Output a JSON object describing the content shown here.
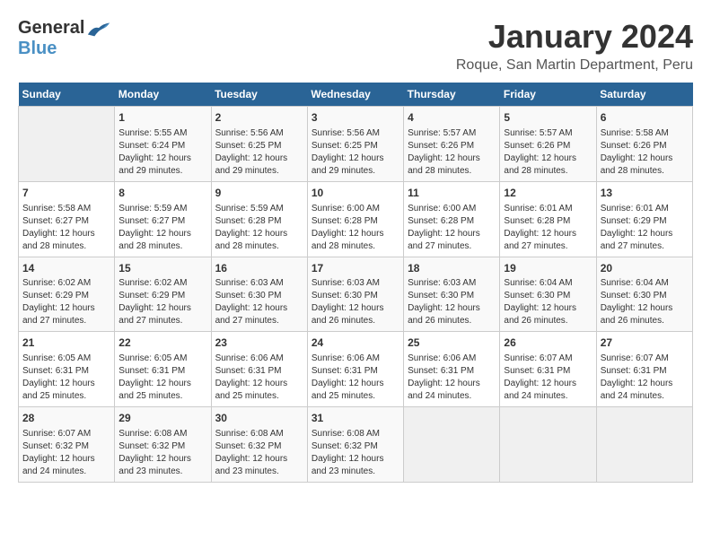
{
  "logo": {
    "general": "General",
    "blue": "Blue"
  },
  "title": "January 2024",
  "subtitle": "Roque, San Martin Department, Peru",
  "days_of_week": [
    "Sunday",
    "Monday",
    "Tuesday",
    "Wednesday",
    "Thursday",
    "Friday",
    "Saturday"
  ],
  "weeks": [
    [
      {
        "day": "",
        "info": ""
      },
      {
        "day": "1",
        "info": "Sunrise: 5:55 AM\nSunset: 6:24 PM\nDaylight: 12 hours\nand 29 minutes."
      },
      {
        "day": "2",
        "info": "Sunrise: 5:56 AM\nSunset: 6:25 PM\nDaylight: 12 hours\nand 29 minutes."
      },
      {
        "day": "3",
        "info": "Sunrise: 5:56 AM\nSunset: 6:25 PM\nDaylight: 12 hours\nand 29 minutes."
      },
      {
        "day": "4",
        "info": "Sunrise: 5:57 AM\nSunset: 6:26 PM\nDaylight: 12 hours\nand 28 minutes."
      },
      {
        "day": "5",
        "info": "Sunrise: 5:57 AM\nSunset: 6:26 PM\nDaylight: 12 hours\nand 28 minutes."
      },
      {
        "day": "6",
        "info": "Sunrise: 5:58 AM\nSunset: 6:26 PM\nDaylight: 12 hours\nand 28 minutes."
      }
    ],
    [
      {
        "day": "7",
        "info": "Sunrise: 5:58 AM\nSunset: 6:27 PM\nDaylight: 12 hours\nand 28 minutes."
      },
      {
        "day": "8",
        "info": "Sunrise: 5:59 AM\nSunset: 6:27 PM\nDaylight: 12 hours\nand 28 minutes."
      },
      {
        "day": "9",
        "info": "Sunrise: 5:59 AM\nSunset: 6:28 PM\nDaylight: 12 hours\nand 28 minutes."
      },
      {
        "day": "10",
        "info": "Sunrise: 6:00 AM\nSunset: 6:28 PM\nDaylight: 12 hours\nand 28 minutes."
      },
      {
        "day": "11",
        "info": "Sunrise: 6:00 AM\nSunset: 6:28 PM\nDaylight: 12 hours\nand 27 minutes."
      },
      {
        "day": "12",
        "info": "Sunrise: 6:01 AM\nSunset: 6:28 PM\nDaylight: 12 hours\nand 27 minutes."
      },
      {
        "day": "13",
        "info": "Sunrise: 6:01 AM\nSunset: 6:29 PM\nDaylight: 12 hours\nand 27 minutes."
      }
    ],
    [
      {
        "day": "14",
        "info": "Sunrise: 6:02 AM\nSunset: 6:29 PM\nDaylight: 12 hours\nand 27 minutes."
      },
      {
        "day": "15",
        "info": "Sunrise: 6:02 AM\nSunset: 6:29 PM\nDaylight: 12 hours\nand 27 minutes."
      },
      {
        "day": "16",
        "info": "Sunrise: 6:03 AM\nSunset: 6:30 PM\nDaylight: 12 hours\nand 27 minutes."
      },
      {
        "day": "17",
        "info": "Sunrise: 6:03 AM\nSunset: 6:30 PM\nDaylight: 12 hours\nand 26 minutes."
      },
      {
        "day": "18",
        "info": "Sunrise: 6:03 AM\nSunset: 6:30 PM\nDaylight: 12 hours\nand 26 minutes."
      },
      {
        "day": "19",
        "info": "Sunrise: 6:04 AM\nSunset: 6:30 PM\nDaylight: 12 hours\nand 26 minutes."
      },
      {
        "day": "20",
        "info": "Sunrise: 6:04 AM\nSunset: 6:30 PM\nDaylight: 12 hours\nand 26 minutes."
      }
    ],
    [
      {
        "day": "21",
        "info": "Sunrise: 6:05 AM\nSunset: 6:31 PM\nDaylight: 12 hours\nand 25 minutes."
      },
      {
        "day": "22",
        "info": "Sunrise: 6:05 AM\nSunset: 6:31 PM\nDaylight: 12 hours\nand 25 minutes."
      },
      {
        "day": "23",
        "info": "Sunrise: 6:06 AM\nSunset: 6:31 PM\nDaylight: 12 hours\nand 25 minutes."
      },
      {
        "day": "24",
        "info": "Sunrise: 6:06 AM\nSunset: 6:31 PM\nDaylight: 12 hours\nand 25 minutes."
      },
      {
        "day": "25",
        "info": "Sunrise: 6:06 AM\nSunset: 6:31 PM\nDaylight: 12 hours\nand 24 minutes."
      },
      {
        "day": "26",
        "info": "Sunrise: 6:07 AM\nSunset: 6:31 PM\nDaylight: 12 hours\nand 24 minutes."
      },
      {
        "day": "27",
        "info": "Sunrise: 6:07 AM\nSunset: 6:31 PM\nDaylight: 12 hours\nand 24 minutes."
      }
    ],
    [
      {
        "day": "28",
        "info": "Sunrise: 6:07 AM\nSunset: 6:32 PM\nDaylight: 12 hours\nand 24 minutes."
      },
      {
        "day": "29",
        "info": "Sunrise: 6:08 AM\nSunset: 6:32 PM\nDaylight: 12 hours\nand 23 minutes."
      },
      {
        "day": "30",
        "info": "Sunrise: 6:08 AM\nSunset: 6:32 PM\nDaylight: 12 hours\nand 23 minutes."
      },
      {
        "day": "31",
        "info": "Sunrise: 6:08 AM\nSunset: 6:32 PM\nDaylight: 12 hours\nand 23 minutes."
      },
      {
        "day": "",
        "info": ""
      },
      {
        "day": "",
        "info": ""
      },
      {
        "day": "",
        "info": ""
      }
    ]
  ]
}
